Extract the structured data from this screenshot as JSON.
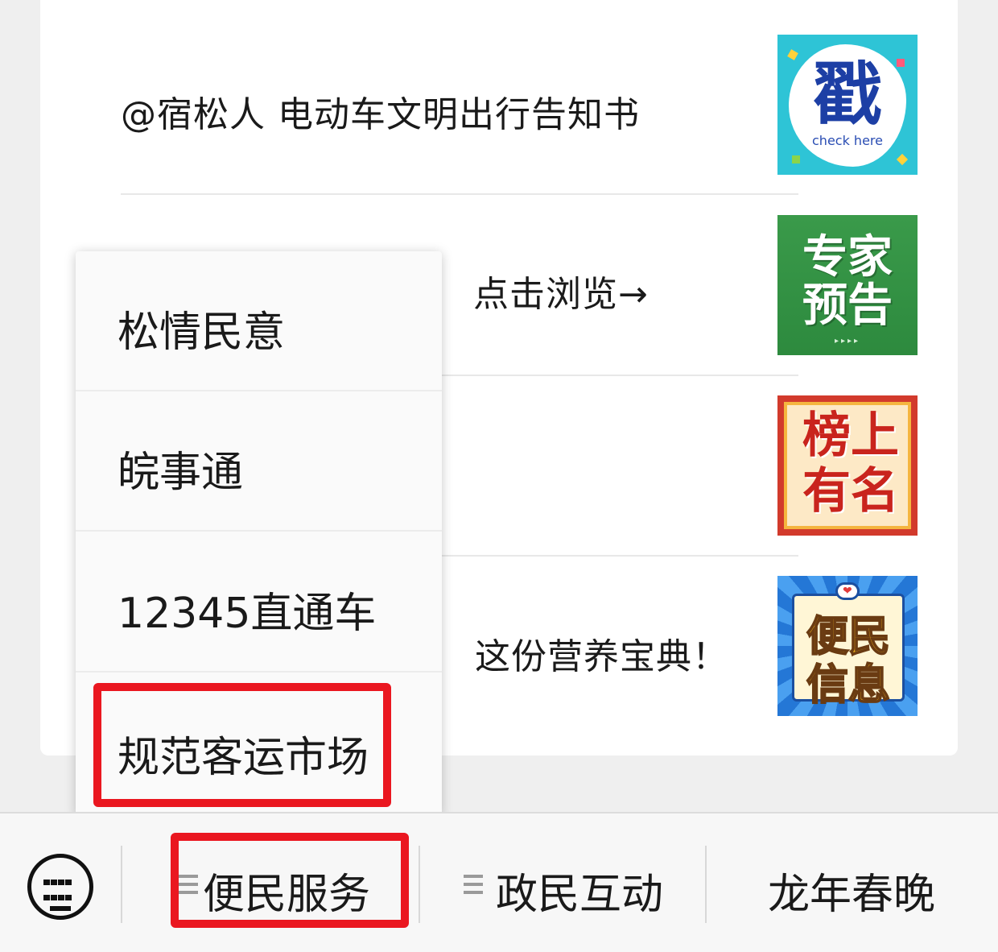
{
  "articles": [
    {
      "title": "@宿松人  电动车文明出行告知书",
      "thumb_lines": [
        "戳",
        "check here"
      ]
    },
    {
      "title": "点击浏览→",
      "thumb_lines": [
        "专家",
        "预告"
      ]
    },
    {
      "title": "",
      "thumb_lines": [
        "榜上",
        "有名"
      ]
    },
    {
      "title": "这份营养宝典！",
      "thumb_lines": [
        "便民",
        "信息"
      ]
    }
  ],
  "popup_menu": {
    "items": [
      "松情民意",
      "皖事通",
      "12345直通车",
      "规范客运市场"
    ],
    "highlighted_item": "规范客运市场"
  },
  "bottom_bar": {
    "tabs": [
      "便民服务",
      "政民互动",
      "龙年春晚"
    ],
    "active_tab": "便民服务"
  },
  "colors": {
    "highlight": "#ea1720",
    "background": "#efefef"
  }
}
